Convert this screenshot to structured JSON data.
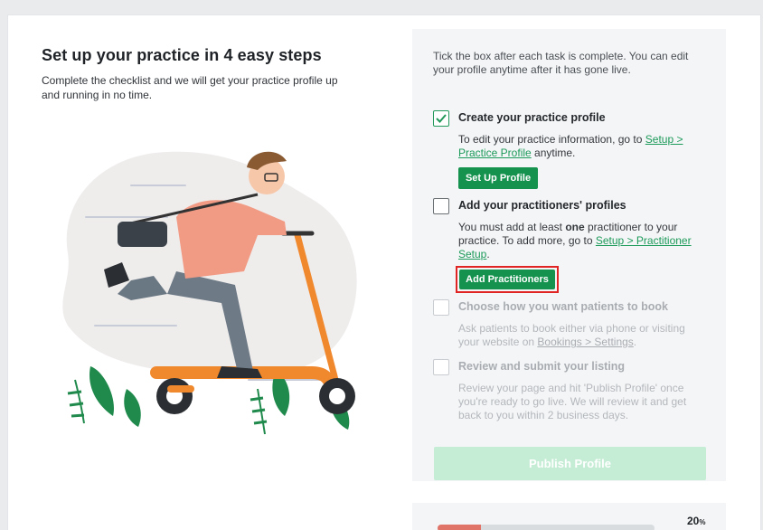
{
  "header": {
    "title": "Set up your practice in 4 easy steps",
    "subtitle": "Complete the checklist and we will get your practice profile up and running in no time."
  },
  "checklist": {
    "intro": "Tick the box after each task is complete. You can edit your profile anytime after it has gone live.",
    "tasks": [
      {
        "title": "Create your practice profile",
        "checked": true,
        "body_pre": "To edit your practice information, go to ",
        "link": "Setup > Practice Profile",
        "body_post": " anytime.",
        "button": "Set Up Profile"
      },
      {
        "title": "Add your practitioners' profiles",
        "checked": false,
        "body_pre": "You must add at least ",
        "body_bold": "one",
        "body_mid": " practitioner to your practice. To add more, go to ",
        "link": "Setup > Practitioner Setup",
        "body_post": ".",
        "button": "Add Practitioners"
      },
      {
        "title": "Choose how you want patients to book",
        "checked": false,
        "disabled": true,
        "body_pre": "Ask patients to book either via phone or visiting your website on ",
        "link": "Bookings > Settings",
        "body_post": "."
      },
      {
        "title": "Review and submit your listing",
        "checked": false,
        "disabled": true,
        "body": "Review your page and hit 'Publish Profile' once you're ready to go live. We will review it and get back to you within 2 business days."
      }
    ],
    "publish_button": "Publish Profile"
  },
  "progress": {
    "percent_value": "20",
    "percent_sign": "%",
    "fraction": 0.2
  },
  "colors": {
    "accent": "#16924f",
    "highlight": "#e02424",
    "progress": "#e07468"
  }
}
